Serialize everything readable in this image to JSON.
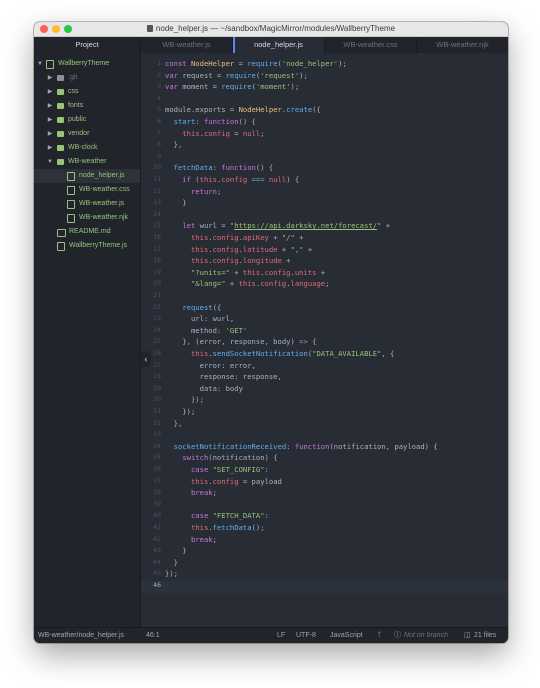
{
  "window": {
    "title": "node_helper.js — ~/sandbox/MagicMirror/modules/WallberryTheme"
  },
  "tabs": {
    "project_label": "Project",
    "items": [
      {
        "label": "WB-weather.js"
      },
      {
        "label": "node_helper.js"
      },
      {
        "label": "WB-weather.css"
      },
      {
        "label": "WB-weather.njk"
      }
    ]
  },
  "tree": {
    "root": "WallberryTheme",
    "items": [
      {
        "label": ".git"
      },
      {
        "label": "css"
      },
      {
        "label": "fonts"
      },
      {
        "label": "public"
      },
      {
        "label": "vendor"
      },
      {
        "label": "WB-clock"
      },
      {
        "label": "WB-weather"
      },
      {
        "label": "node_helper.js"
      },
      {
        "label": "WB-weather.css"
      },
      {
        "label": "WB-weather.js"
      },
      {
        "label": "WB-weather.njk"
      },
      {
        "label": "README.md"
      },
      {
        "label": "WallberryTheme.js"
      }
    ]
  },
  "editor": {
    "line_numbers": [
      "1",
      "2",
      "3",
      "4",
      "5",
      "6",
      "7",
      "8",
      "9",
      "10",
      "11",
      "12",
      "13",
      "14",
      "15",
      "16",
      "17",
      "18",
      "19",
      "20",
      "21",
      "22",
      "23",
      "24",
      "25",
      "26",
      "27",
      "28",
      "29",
      "30",
      "31",
      "32",
      "33",
      "34",
      "35",
      "36",
      "37",
      "38",
      "39",
      "40",
      "41",
      "42",
      "43",
      "44",
      "45",
      "46"
    ],
    "lines": [
      [
        [
          "kw",
          "const "
        ],
        [
          "var",
          "NodeHelper"
        ],
        [
          "pl",
          " = "
        ],
        [
          "fn",
          "require"
        ],
        [
          "pl",
          "("
        ],
        [
          "str",
          "'node_helper'"
        ],
        [
          "pl",
          ");"
        ]
      ],
      [
        [
          "kw",
          "var "
        ],
        [
          "pl",
          "request = "
        ],
        [
          "fn",
          "require"
        ],
        [
          "pl",
          "("
        ],
        [
          "str",
          "'request'"
        ],
        [
          "pl",
          ");"
        ]
      ],
      [
        [
          "kw",
          "var "
        ],
        [
          "pl",
          "moment = "
        ],
        [
          "fn",
          "require"
        ],
        [
          "pl",
          "("
        ],
        [
          "str",
          "'moment'"
        ],
        [
          "pl",
          ");"
        ]
      ],
      [],
      [
        [
          "pl",
          "module.exports = "
        ],
        [
          "var",
          "NodeHelper"
        ],
        [
          "pl",
          "."
        ],
        [
          "fn",
          "create"
        ],
        [
          "pl",
          "({"
        ]
      ],
      [
        [
          "pl",
          "  "
        ],
        [
          "fn",
          "start"
        ],
        [
          "pl",
          ": "
        ],
        [
          "kw",
          "function"
        ],
        [
          "pl",
          "() {"
        ]
      ],
      [
        [
          "pl",
          "    "
        ],
        [
          "this",
          "this"
        ],
        [
          "pl",
          "."
        ],
        [
          "this",
          "config"
        ],
        [
          "pl",
          " = "
        ],
        [
          "this",
          "null"
        ],
        [
          "pl",
          ";"
        ]
      ],
      [
        [
          "pl",
          "  },"
        ]
      ],
      [],
      [
        [
          "pl",
          "  "
        ],
        [
          "fn",
          "fetchData"
        ],
        [
          "pl",
          ": "
        ],
        [
          "kw",
          "function"
        ],
        [
          "pl",
          "() {"
        ]
      ],
      [
        [
          "pl",
          "    "
        ],
        [
          "kw",
          "if"
        ],
        [
          "pl",
          " ("
        ],
        [
          "this",
          "this"
        ],
        [
          "pl",
          "."
        ],
        [
          "this",
          "config"
        ],
        [
          "pl",
          " "
        ],
        [
          "op",
          "==="
        ],
        [
          "pl",
          " "
        ],
        [
          "this",
          "null"
        ],
        [
          "pl",
          ") {"
        ]
      ],
      [
        [
          "pl",
          "      "
        ],
        [
          "kw",
          "return"
        ],
        [
          "pl",
          ";"
        ]
      ],
      [
        [
          "pl",
          "    }"
        ]
      ],
      [],
      [
        [
          "pl",
          "    "
        ],
        [
          "kw",
          "let "
        ],
        [
          "pl",
          "wurl = "
        ],
        [
          "str",
          "\""
        ],
        [
          "url",
          "https://api.darksky.net/forecast/"
        ],
        [
          "str",
          "\""
        ],
        [
          "pl",
          " +"
        ]
      ],
      [
        [
          "pl",
          "      "
        ],
        [
          "this",
          "this"
        ],
        [
          "pl",
          "."
        ],
        [
          "this",
          "config"
        ],
        [
          "pl",
          "."
        ],
        [
          "this",
          "apiKey"
        ],
        [
          "pl",
          " + "
        ],
        [
          "str",
          "\"/\""
        ],
        [
          "pl",
          " +"
        ]
      ],
      [
        [
          "pl",
          "      "
        ],
        [
          "this",
          "this"
        ],
        [
          "pl",
          "."
        ],
        [
          "this",
          "config"
        ],
        [
          "pl",
          "."
        ],
        [
          "this",
          "latitude"
        ],
        [
          "pl",
          " + "
        ],
        [
          "str",
          "\",\""
        ],
        [
          "pl",
          " +"
        ]
      ],
      [
        [
          "pl",
          "      "
        ],
        [
          "this",
          "this"
        ],
        [
          "pl",
          "."
        ],
        [
          "this",
          "config"
        ],
        [
          "pl",
          "."
        ],
        [
          "this",
          "longitude"
        ],
        [
          "pl",
          " +"
        ]
      ],
      [
        [
          "pl",
          "      "
        ],
        [
          "str",
          "\"?units=\""
        ],
        [
          "pl",
          " + "
        ],
        [
          "this",
          "this"
        ],
        [
          "pl",
          "."
        ],
        [
          "this",
          "config"
        ],
        [
          "pl",
          "."
        ],
        [
          "this",
          "units"
        ],
        [
          "pl",
          " +"
        ]
      ],
      [
        [
          "pl",
          "      "
        ],
        [
          "str",
          "\"&lang=\""
        ],
        [
          "pl",
          " + "
        ],
        [
          "this",
          "this"
        ],
        [
          "pl",
          "."
        ],
        [
          "this",
          "config"
        ],
        [
          "pl",
          "."
        ],
        [
          "this",
          "language"
        ],
        [
          "pl",
          ";"
        ]
      ],
      [],
      [
        [
          "pl",
          "    "
        ],
        [
          "fn",
          "request"
        ],
        [
          "pl",
          "({"
        ]
      ],
      [
        [
          "pl",
          "      url: wurl,"
        ]
      ],
      [
        [
          "pl",
          "      method: "
        ],
        [
          "str",
          "'GET'"
        ]
      ],
      [
        [
          "pl",
          "    }, (error, response, body) "
        ],
        [
          "kw",
          "=>"
        ],
        [
          "pl",
          " {"
        ]
      ],
      [
        [
          "pl",
          "      "
        ],
        [
          "this",
          "this"
        ],
        [
          "pl",
          "."
        ],
        [
          "fn",
          "sendSocketNotification"
        ],
        [
          "pl",
          "("
        ],
        [
          "str",
          "\"DATA_AVAILABLE\""
        ],
        [
          "pl",
          ", {"
        ]
      ],
      [
        [
          "pl",
          "        error: error,"
        ]
      ],
      [
        [
          "pl",
          "        response: response,"
        ]
      ],
      [
        [
          "pl",
          "        data: body"
        ]
      ],
      [
        [
          "pl",
          "      });"
        ]
      ],
      [
        [
          "pl",
          "    });"
        ]
      ],
      [
        [
          "pl",
          "  },"
        ]
      ],
      [],
      [
        [
          "pl",
          "  "
        ],
        [
          "fn",
          "socketNotificationReceived"
        ],
        [
          "pl",
          ": "
        ],
        [
          "kw",
          "function"
        ],
        [
          "pl",
          "(notification, payload) {"
        ]
      ],
      [
        [
          "pl",
          "    "
        ],
        [
          "kw",
          "switch"
        ],
        [
          "pl",
          "(notification) {"
        ]
      ],
      [
        [
          "pl",
          "      "
        ],
        [
          "kw",
          "case "
        ],
        [
          "str",
          "\"SET_CONFIG\""
        ],
        [
          "pl",
          ":"
        ]
      ],
      [
        [
          "pl",
          "      "
        ],
        [
          "this",
          "this"
        ],
        [
          "pl",
          "."
        ],
        [
          "this",
          "config"
        ],
        [
          "pl",
          " = payload"
        ]
      ],
      [
        [
          "pl",
          "      "
        ],
        [
          "kw",
          "break"
        ],
        [
          "pl",
          ";"
        ]
      ],
      [],
      [
        [
          "pl",
          "      "
        ],
        [
          "kw",
          "case "
        ],
        [
          "str",
          "\"FETCH_DATA\""
        ],
        [
          "pl",
          ":"
        ]
      ],
      [
        [
          "pl",
          "      "
        ],
        [
          "this",
          "this"
        ],
        [
          "pl",
          "."
        ],
        [
          "fn",
          "fetchData"
        ],
        [
          "pl",
          "();"
        ]
      ],
      [
        [
          "pl",
          "      "
        ],
        [
          "kw",
          "break"
        ],
        [
          "pl",
          ";"
        ]
      ],
      [
        [
          "pl",
          "    }"
        ]
      ],
      [
        [
          "pl",
          "  }"
        ]
      ],
      [
        [
          "pl",
          "});"
        ]
      ],
      []
    ]
  },
  "status": {
    "path": "WB-weather/node_helper.js",
    "cursor": "46:1",
    "line_ending": "LF",
    "encoding": "UTF-8",
    "grammar": "JavaScript",
    "branch": "Not on branch",
    "files": "21 files"
  },
  "icons": {
    "collapse": "chevron-left-icon",
    "folder": "folder-icon",
    "file": "file-icon"
  }
}
